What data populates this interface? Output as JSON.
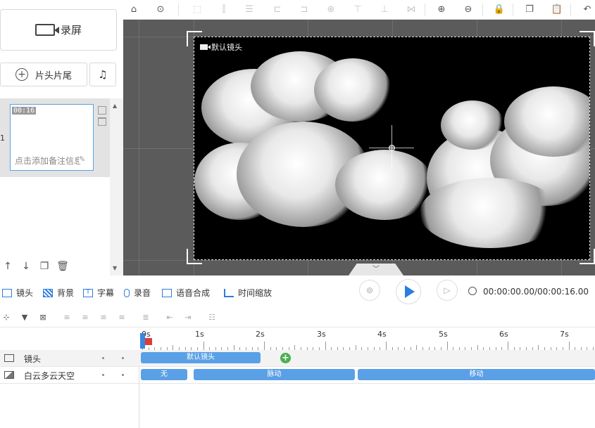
{
  "left_panel": {
    "record_label": "录屏",
    "headtail_label": "片头片尾",
    "scene": {
      "index": "1",
      "duration": "00:16",
      "note_placeholder": "点击添加备注信息"
    }
  },
  "player": {
    "camera_label": "默认镜头"
  },
  "timeline_tools": [
    {
      "label": "镜头",
      "icon": "camera-icon"
    },
    {
      "label": "背景",
      "icon": "background-icon"
    },
    {
      "label": "字幕",
      "icon": "subtitle-icon"
    },
    {
      "label": "录音",
      "icon": "microphone-icon"
    },
    {
      "label": "语音合成",
      "icon": "tts-icon"
    },
    {
      "label": "时间缩放",
      "icon": "time-scale-icon"
    }
  ],
  "time_readout": "00:00:00.00/00:00:16.00",
  "ruler_labels": [
    "0s",
    "1s",
    "2s",
    "3s",
    "4s",
    "5s",
    "6s",
    "7s"
  ],
  "tracks": [
    {
      "name": "镜头",
      "clips": [
        {
          "label": "默认镜头"
        }
      ]
    },
    {
      "name": "白云多云天空",
      "clips": [
        {
          "label": "无"
        },
        {
          "label": "脉动"
        },
        {
          "label": "移动"
        }
      ]
    }
  ],
  "colors": {
    "accent": "#2b7de0",
    "clip": "#5aa0e6",
    "add": "#4caf50",
    "marker": "#e03b3b"
  }
}
